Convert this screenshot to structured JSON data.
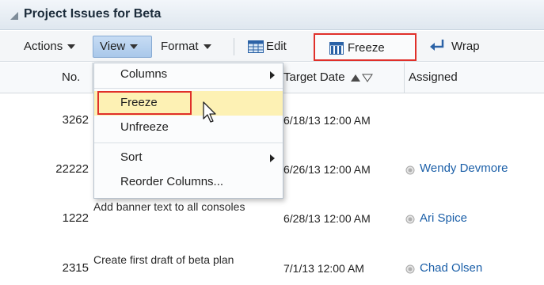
{
  "panel": {
    "title": "Project Issues for Beta"
  },
  "toolbar": {
    "actions_label": "Actions",
    "view_label": "View",
    "format_label": "Format",
    "edit_label": "Edit",
    "freeze_label": "Freeze",
    "wrap_label": "Wrap"
  },
  "columns": {
    "no": "No.",
    "target_date": "Target Date",
    "assigned": "Assigned"
  },
  "rows": [
    {
      "no": "3262",
      "summary": "",
      "date": "6/18/13 12:00 AM",
      "assigned": ""
    },
    {
      "no": "22222",
      "summary": "",
      "date": "6/26/13 12:00 AM",
      "assigned": "Wendy Devmore"
    },
    {
      "no": "1222",
      "summary": "Add banner text to all consoles",
      "date": "6/28/13 12:00 AM",
      "assigned": "Ari Spice"
    },
    {
      "no": "2315",
      "summary": "Create first draft of beta plan",
      "date": "7/1/13 12:00 AM",
      "assigned": "Chad Olsen"
    }
  ],
  "view_menu": {
    "columns": "Columns",
    "freeze": "Freeze",
    "unfreeze": "Unfreeze",
    "sort": "Sort",
    "reorder": "Reorder Columns..."
  },
  "colors": {
    "highlight": "#fdf1b4",
    "callout_border": "#e0302a",
    "link": "#1b5fa8",
    "selected_menu": "#a9c8ea"
  },
  "icons": [
    "collapse-triangle-icon",
    "edit-icon",
    "freeze-icon",
    "wrap-icon",
    "sort-ascending-icon",
    "sort-descending-icon",
    "person-status-icon",
    "mouse-pointer-icon"
  ]
}
